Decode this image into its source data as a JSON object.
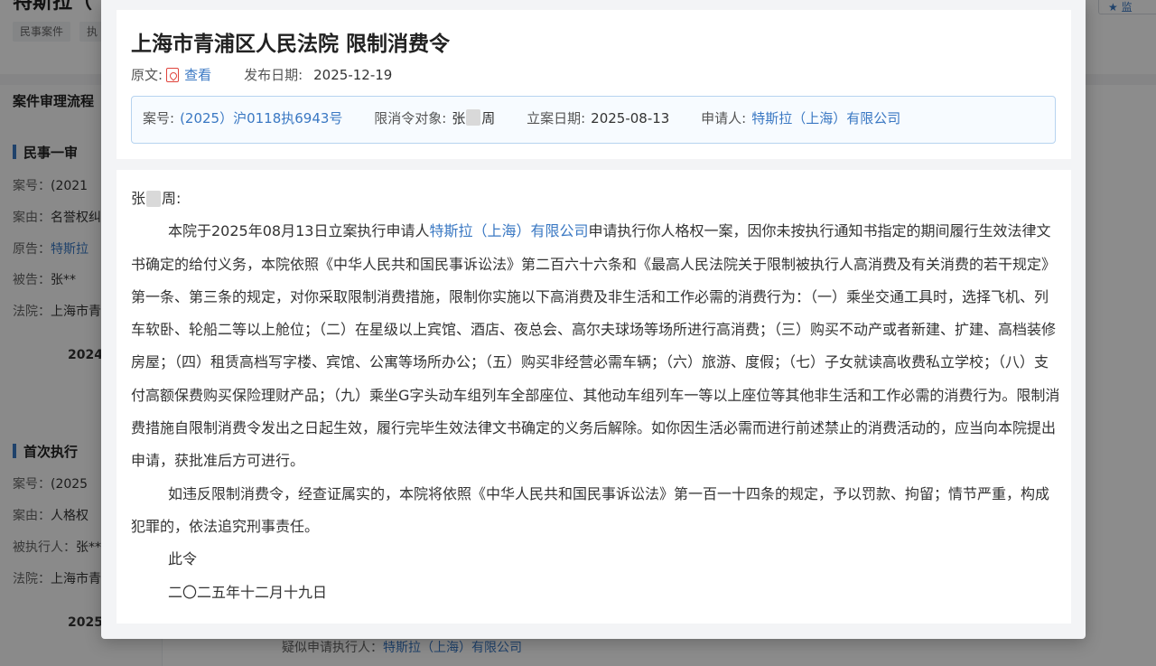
{
  "background": {
    "title": "特斯拉（",
    "tags": [
      "民事案件",
      "执"
    ],
    "top_button": "监",
    "section_title": "案件审理流程",
    "first_instance": {
      "heading": "民事一审",
      "rows": [
        {
          "label": "案号：",
          "value": "(2021"
        },
        {
          "label": "案由：",
          "value": "名誉权纠"
        },
        {
          "label": "原告：",
          "value": "特斯拉"
        },
        {
          "label": "被告：",
          "value": "张**"
        },
        {
          "label": "法院：",
          "value": "上海市青"
        }
      ],
      "year": "2024"
    },
    "first_execution": {
      "heading": "首次执行",
      "rows": [
        {
          "label": "案号：",
          "value": "(2025"
        },
        {
          "label": "案由：",
          "value": "人格权"
        },
        {
          "label": "被执行人：",
          "value": "张**"
        },
        {
          "label": "法院：",
          "value": "上海市青"
        }
      ],
      "year": "2025"
    },
    "bottom_line": {
      "label": "疑似申请执行人：",
      "value": "特斯拉（上海）有限公司"
    }
  },
  "modal": {
    "title": "上海市青浦区人民法院 限制消费令",
    "source_label": "原文:",
    "view_label": "查看",
    "publish_label": "发布日期:",
    "publish_date": "2025-12-19",
    "info": {
      "case_no_label": "案号:",
      "case_no": "(2025）沪0118执6943号",
      "target_label": "限消令对象:",
      "target_prefix": "张",
      "target_suffix": "周",
      "filing_label": "立案日期:",
      "filing_date": "2025-08-13",
      "applicant_label": "申请人:",
      "applicant": "特斯拉（上海）有限公司"
    },
    "letter": {
      "salutation_prefix": "张",
      "salutation_suffix": "周:",
      "p1_before": "本院于2025年08月13日立案执行申请人",
      "p1_company": "特斯拉（上海）有限公司",
      "p1_after": "申请执行你人格权一案，因你未按执行通知书指定的期间履行生效法律文书确定的给付义务，本院依照《中华人民共和国民事诉讼法》第二百六十六条和《最高人民法院关于限制被执行人高消费及有关消费的若干规定》第一条、第三条的规定，对你采取限制消费措施，限制你实施以下高消费及非生活和工作必需的消费行为：（一）乘坐交通工具时，选择飞机、列车软卧、轮船二等以上舱位；（二）在星级以上宾馆、酒店、夜总会、高尔夫球场等场所进行高消费；（三）购买不动产或者新建、扩建、高档装修房屋；（四）租赁高档写字楼、宾馆、公寓等场所办公；（五）购买非经营必需车辆；（六）旅游、度假；（七）子女就读高收费私立学校；（八）支付高额保费购买保险理财产品；（九）乘坐G字头动车组列车全部座位、其他动车组列车一等以上座位等其他非生活和工作必需的消费行为。限制消费措施自限制消费令发出之日起生效，履行完毕生效法律文书确定的义务后解除。如你因生活必需而进行前述禁止的消费活动的，应当向本院提出申请，获批准后方可进行。",
      "p2": "如违反限制消费令，经查证属实的，本院将依照《中华人民共和国民事诉讼法》第一百一十四条的规定，予以罚款、拘留；情节严重，构成犯罪的，依法追究刑事责任。",
      "closing": "此令",
      "date": "二〇二五年十二月十九日"
    }
  },
  "colors": {
    "link": "#3a78c3",
    "info_border": "#b7d3ef",
    "pdf_red": "#e0443c",
    "accent_bar": "#3a78c3"
  }
}
